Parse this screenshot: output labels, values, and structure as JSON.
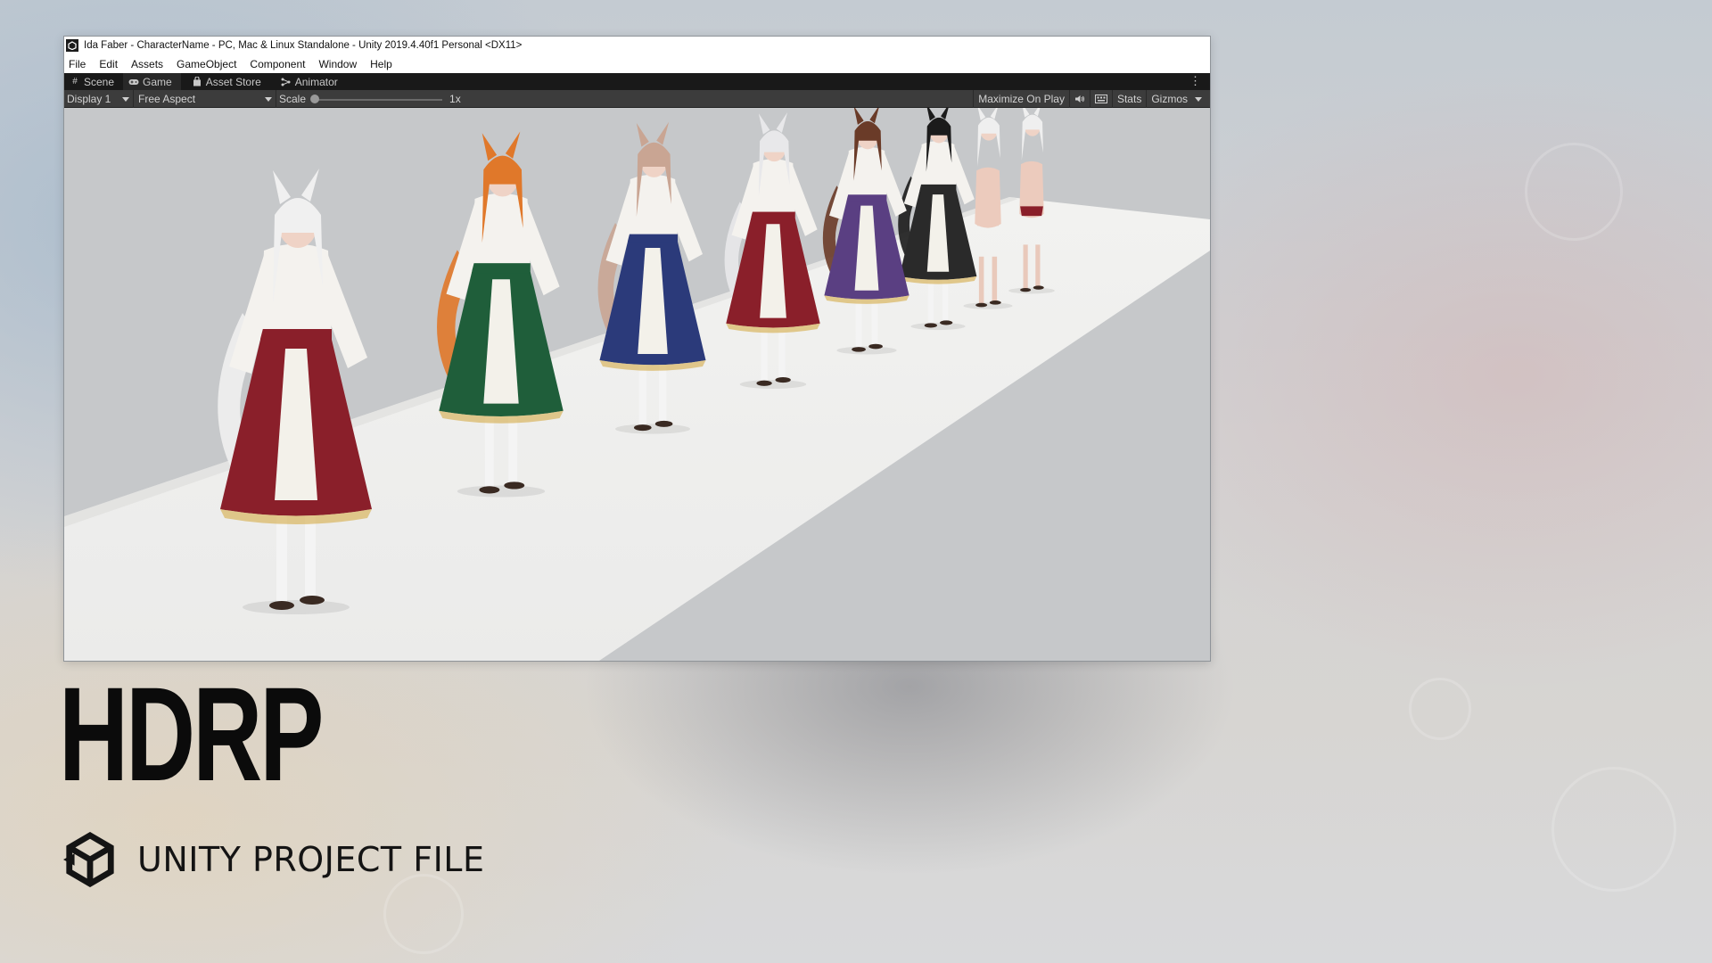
{
  "window": {
    "title": "Ida Faber - CharacterName - PC, Mac & Linux Standalone - Unity 2019.4.40f1 Personal <DX11>"
  },
  "menubar": {
    "items": [
      "File",
      "Edit",
      "Assets",
      "GameObject",
      "Component",
      "Window",
      "Help"
    ]
  },
  "tabs": [
    {
      "label": "Scene",
      "icon": "grid-icon",
      "active": false
    },
    {
      "label": "Game",
      "icon": "gamepad-icon",
      "active": true
    },
    {
      "label": "Asset Store",
      "icon": "shopping-bag-icon",
      "active": false
    },
    {
      "label": "Animator",
      "icon": "animator-icon",
      "active": false
    }
  ],
  "game_toolbar": {
    "display": "Display 1",
    "aspect": "Free Aspect",
    "scale_label": "Scale",
    "scale_value": "1x",
    "scale_fraction": 0.0,
    "maximize": "Maximize On Play",
    "stats": "Stats",
    "gizmos": "Gizmos"
  },
  "branding": {
    "headline": "HDRP",
    "subtitle": "UNITY PROJECT FILE"
  },
  "colors": {
    "window_background": "#ffffff",
    "tab_bar": "#191919",
    "toolbar": "#3c3c3c",
    "floor": "#efefed",
    "viewport_background": "#c8cacc",
    "outfits": [
      "#8a1f2a",
      "#1f5e3a",
      "#2b3a7a",
      "#8a1f2a",
      "#5a3f82",
      "#2a2a2a"
    ]
  }
}
